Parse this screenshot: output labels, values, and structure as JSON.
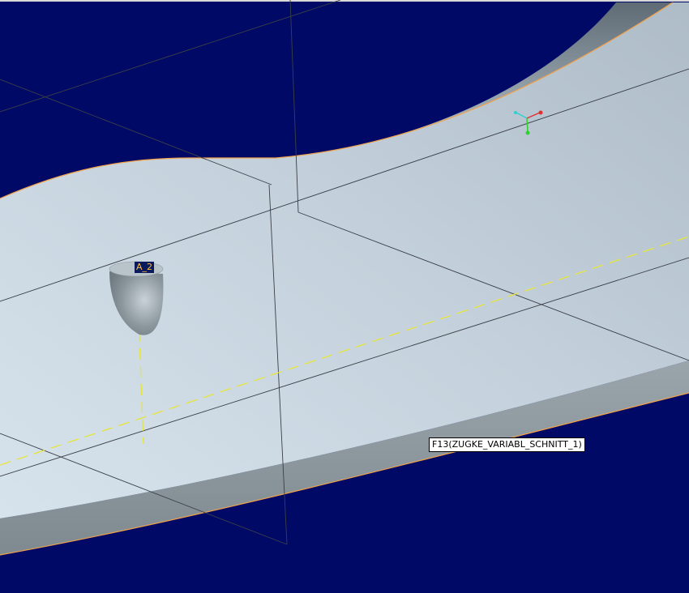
{
  "viewport": {
    "background_color": "#000a66"
  },
  "model": {
    "surface_color": "#c4d1dc",
    "side_wall_color": "#8c989e",
    "edge_highlight_color": "#f2a24a",
    "datum_plane_color": "#3b3f46",
    "datum_axis_color": "#e6e639"
  },
  "datum_tag": {
    "text": "A_2"
  },
  "tooltip": {
    "text": "F13(ZUGKE_VARIABL_SCHNITT_1)"
  },
  "csys_icon": {
    "name": "coordinate-system-icon",
    "x_color": "#e03030",
    "y_color": "#30d030",
    "z_color": "#30d0d0"
  }
}
